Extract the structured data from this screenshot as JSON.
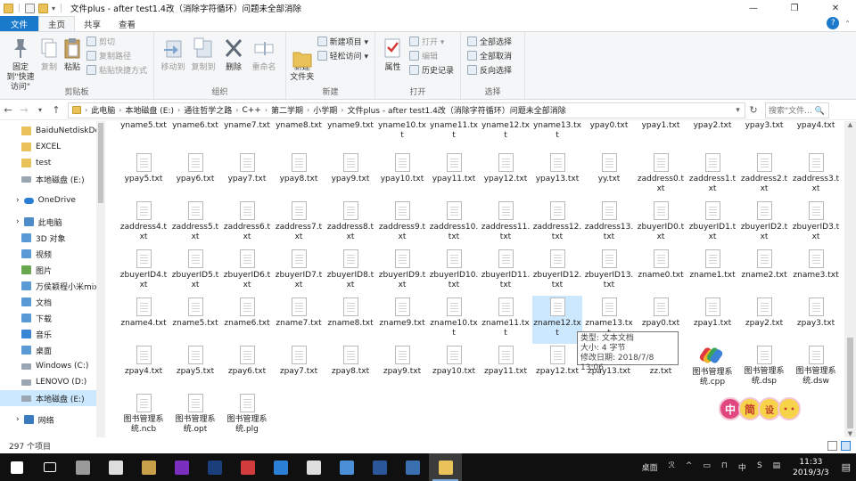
{
  "window": {
    "title": "文件plus - after test1.4改（消除字符循环）问题未全部消除",
    "controls": [
      "—",
      "❐",
      "✕"
    ]
  },
  "ribbon_tabs": [
    {
      "label": "文件",
      "kind": "file"
    },
    {
      "label": "主页",
      "kind": "active"
    },
    {
      "label": "共享",
      "kind": "normal"
    },
    {
      "label": "查看",
      "kind": "normal"
    }
  ],
  "ribbon": {
    "clipboard": {
      "label": "剪贴板",
      "pin": "固定到\"快速访问\"",
      "copy": "复制",
      "paste": "粘贴",
      "cut": "剪切",
      "copy_path": "复制路径",
      "paste_shortcut": "粘贴快捷方式"
    },
    "organize": {
      "label": "组织",
      "move_to": "移动到",
      "copy_to": "复制到",
      "delete": "删除",
      "rename": "重命名"
    },
    "new": {
      "label": "新建",
      "new_folder": "新建\n文件夹",
      "new_item": "新建项目 ▾",
      "easy_access": "轻松访问 ▾"
    },
    "open": {
      "label": "打开",
      "properties": "属性",
      "open": "打开 ▾",
      "edit": "编辑",
      "history": "历史记录"
    },
    "select": {
      "label": "选择",
      "select_all": "全部选择",
      "select_none": "全部取消",
      "invert": "反向选择"
    }
  },
  "address": {
    "crumbs": [
      "此电脑",
      "本地磁盘 (E:)",
      "通往哲学之路",
      "C++",
      "第二学期",
      "小学期",
      "文件plus - after test1.4改（消除字符循环）问题未全部消除"
    ],
    "search_placeholder": "搜索\"文件...  🔍"
  },
  "nav": [
    {
      "label": "BaiduNetdiskDo",
      "icon": "folder",
      "indent": 24
    },
    {
      "label": "EXCEL",
      "icon": "folder",
      "indent": 24
    },
    {
      "label": "test",
      "icon": "folder",
      "indent": 24
    },
    {
      "label": "本地磁盘 (E:)",
      "icon": "drive",
      "indent": 24
    },
    {
      "label": "OneDrive",
      "icon": "cloud",
      "indent": 18
    },
    {
      "label": "此电脑",
      "icon": "pc",
      "indent": 18
    },
    {
      "label": "3D 对象",
      "icon": "blue",
      "indent": 24
    },
    {
      "label": "视频",
      "icon": "blue",
      "indent": 24
    },
    {
      "label": "图片",
      "icon": "img",
      "indent": 24
    },
    {
      "label": "万侯颖程小米mix",
      "icon": "blue",
      "indent": 24
    },
    {
      "label": "文档",
      "icon": "blue",
      "indent": 24
    },
    {
      "label": "下载",
      "icon": "blue",
      "indent": 24
    },
    {
      "label": "音乐",
      "icon": "music",
      "indent": 24
    },
    {
      "label": "桌面",
      "icon": "blue",
      "indent": 24
    },
    {
      "label": "Windows (C:)",
      "icon": "drive",
      "indent": 24
    },
    {
      "label": "LENOVO (D:)",
      "icon": "drive",
      "indent": 24
    },
    {
      "label": "本地磁盘 (E:)",
      "icon": "drive",
      "indent": 24,
      "selected": true
    },
    {
      "label": "网络",
      "icon": "net",
      "indent": 18
    }
  ],
  "files": [
    [
      "yname5.txt",
      "yname6.txt",
      "yname7.txt",
      "yname8.txt",
      "yname9.txt",
      "yname10.txt",
      "yname11.txt",
      "yname12.txt",
      "yname13.txt",
      "ypay0.txt",
      "ypay1.txt",
      "ypay2.txt",
      "ypay3.txt",
      "ypay4.txt"
    ],
    [
      "ypay5.txt",
      "ypay6.txt",
      "ypay7.txt",
      "ypay8.txt",
      "ypay9.txt",
      "ypay10.txt",
      "ypay11.txt",
      "ypay12.txt",
      "ypay13.txt",
      "yy.txt",
      "zaddress0.txt",
      "zaddress1.txt",
      "zaddress2.txt",
      "zaddress3.txt"
    ],
    [
      "zaddress4.txt",
      "zaddress5.txt",
      "zaddress6.txt",
      "zaddress7.txt",
      "zaddress8.txt",
      "zaddress9.txt",
      "zaddress10.txt",
      "zaddress11.txt",
      "zaddress12.txt",
      "zaddress13.txt",
      "zbuyerID0.txt",
      "zbuyerID1.txt",
      "zbuyerID2.txt",
      "zbuyerID3.txt"
    ],
    [
      "zbuyerID4.txt",
      "zbuyerID5.txt",
      "zbuyerID6.txt",
      "zbuyerID7.txt",
      "zbuyerID8.txt",
      "zbuyerID9.txt",
      "zbuyerID10.txt",
      "zbuyerID11.txt",
      "zbuyerID12.txt",
      "zbuyerID13.txt",
      "zname0.txt",
      "zname1.txt",
      "zname2.txt",
      "zname3.txt"
    ],
    [
      "zname4.txt",
      "zname5.txt",
      "zname6.txt",
      "zname7.txt",
      "zname8.txt",
      "zname9.txt",
      "zname10.txt",
      "zname11.txt",
      "zname12.txt",
      "zname13.txt",
      "zpay0.txt",
      "zpay1.txt",
      "zpay2.txt",
      "zpay3.txt"
    ],
    [
      "zpay4.txt",
      "zpay5.txt",
      "zpay6.txt",
      "zpay7.txt",
      "zpay8.txt",
      "zpay9.txt",
      "zpay10.txt",
      "zpay11.txt",
      "zpay12.txt",
      "zpay13.txt",
      "zz.txt",
      "图书管理系统.cpp",
      "图书管理系统.dsp",
      "图书管理系统.dsw"
    ],
    [
      "图书管理系统.ncb",
      "图书管理系统.opt",
      "图书管理系统.plg"
    ]
  ],
  "selected_file": "zname12.txt",
  "tooltip": {
    "type": "类型: 文本文档",
    "size": "大小: 4 字节",
    "modified": "修改日期: 2018/7/8 13:06"
  },
  "stamp_chars": [
    "中",
    "简",
    "设",
    "• •"
  ],
  "status": {
    "count": "297 个项目"
  },
  "taskbar": {
    "apps": [
      {
        "name": "start-icon",
        "color": "#ffffff"
      },
      {
        "name": "task-view-icon",
        "color": "#ffffff"
      },
      {
        "name": "video-app-icon",
        "color": "#9a9a9a"
      },
      {
        "name": "mail-icon",
        "color": "#dddddd"
      },
      {
        "name": "tools-icon",
        "color": "#c9a04a"
      },
      {
        "name": "axure-rp-icon",
        "color": "#7b2fbe"
      },
      {
        "name": "photoshop-icon",
        "color": "#1b3f7a"
      },
      {
        "name": "netease-music-icon",
        "color": "#d23b3b"
      },
      {
        "name": "sogou-icon",
        "color": "#2b7fd4"
      },
      {
        "name": "media-player-icon",
        "color": "#dddddd"
      },
      {
        "name": "bird-app-icon",
        "color": "#4a90d9"
      },
      {
        "name": "word-icon",
        "color": "#2b579a"
      },
      {
        "name": "dev-cpp-icon",
        "color": "#3a6fb0"
      },
      {
        "name": "file-explorer-icon",
        "color": "#e9c25a"
      }
    ],
    "tray_desktop": "桌面",
    "tray_icons": [
      "ℛ",
      "^",
      "▭",
      "⊓",
      "中",
      "S",
      "▤"
    ],
    "time": "11:33",
    "date": "2019/3/3"
  }
}
